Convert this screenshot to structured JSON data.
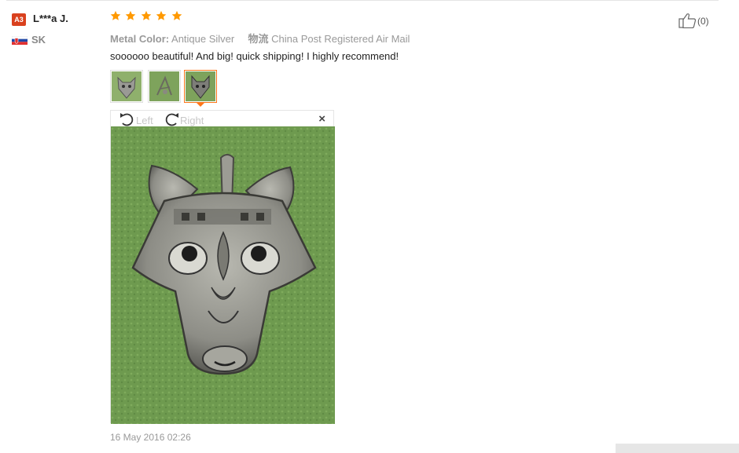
{
  "review": {
    "user_level": "A3",
    "user_name": "L***a J.",
    "country": "SK",
    "rating": 5,
    "metal_color_label": "Metal Color:",
    "metal_color_value": "Antique Silver",
    "shipping_label": "物流",
    "shipping_value": "China Post Registered Air Mail",
    "text": "soooooo beautiful! And big! quick shipping! I highly recommend!",
    "helpful_count": "(0)",
    "date": "16 May 2016 02:26"
  },
  "viewer": {
    "rotate_left": "Left",
    "rotate_right": "Right",
    "close": "×"
  },
  "colors": {
    "star": "#ff9900",
    "level_badge": "#d9411e",
    "active_thumb": "#ff7519",
    "green_felt": "#6e9a4f"
  },
  "icons": [
    "star-icon",
    "rotate-left-icon",
    "rotate-right-icon",
    "close-icon",
    "thumbs-up-icon",
    "flag-icon"
  ]
}
